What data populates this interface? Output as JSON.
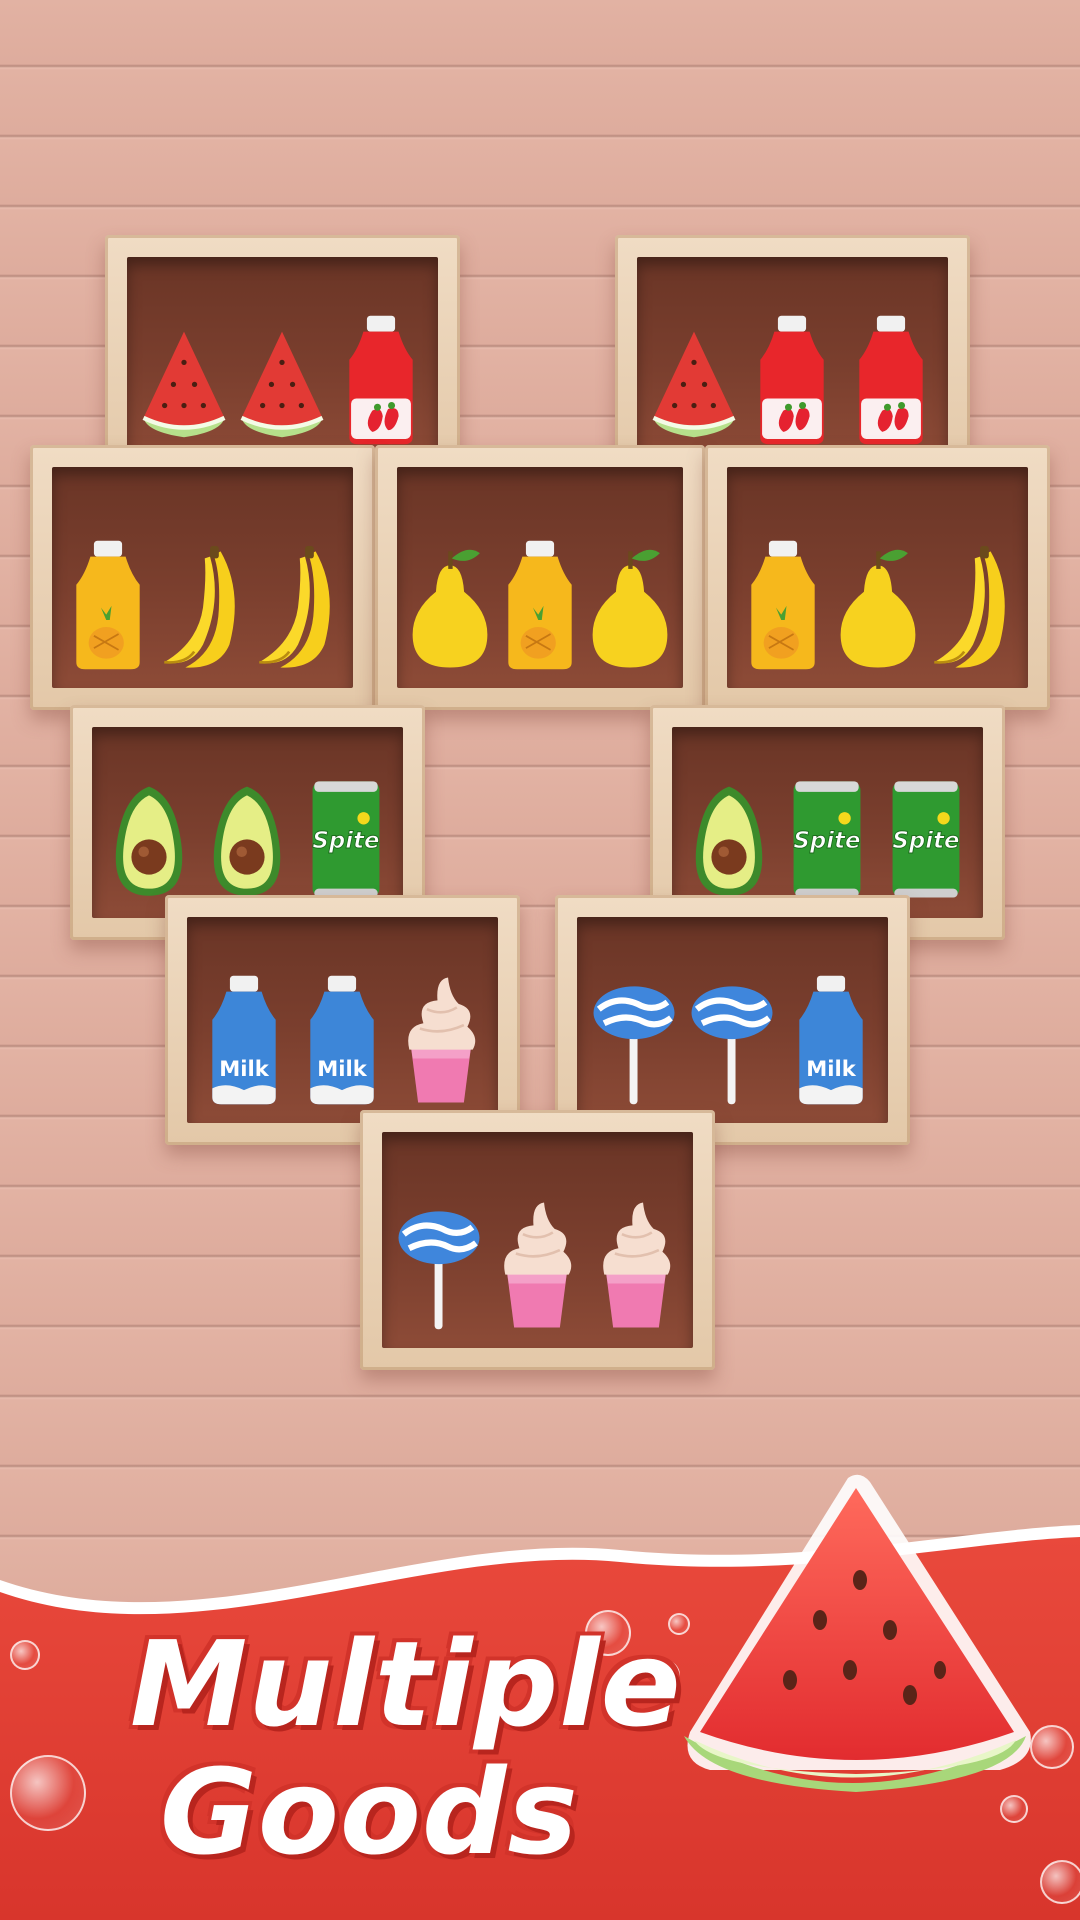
{
  "banner": {
    "line1": "Multiple",
    "line2": "Goods"
  },
  "colors": {
    "banner_red": "#e2453a",
    "shelf_wood": "#ecd6bb",
    "shelf_back": "#7a3e2d"
  },
  "shelves": [
    {
      "items": [
        "watermelon",
        "watermelon",
        "strawberry-drink"
      ]
    },
    {
      "items": [
        "watermelon",
        "strawberry-drink",
        "strawberry-drink"
      ]
    },
    {
      "items": [
        "pineapple-juice",
        "banana",
        "banana"
      ]
    },
    {
      "items": [
        "pear",
        "pineapple-juice",
        "pear"
      ]
    },
    {
      "items": [
        "pineapple-juice",
        "pear",
        "banana"
      ]
    },
    {
      "items": [
        "avocado",
        "avocado",
        "spite-can"
      ]
    },
    {
      "items": [
        "avocado",
        "spite-can",
        "spite-can"
      ]
    },
    {
      "items": [
        "milk-bottle",
        "milk-bottle",
        "ice-cream"
      ]
    },
    {
      "items": [
        "lollipop",
        "lollipop",
        "milk-bottle"
      ]
    },
    {
      "items": [
        "lollipop",
        "ice-cream",
        "ice-cream"
      ]
    }
  ],
  "labels": {
    "milk": "Milk",
    "spite": "Spite"
  }
}
